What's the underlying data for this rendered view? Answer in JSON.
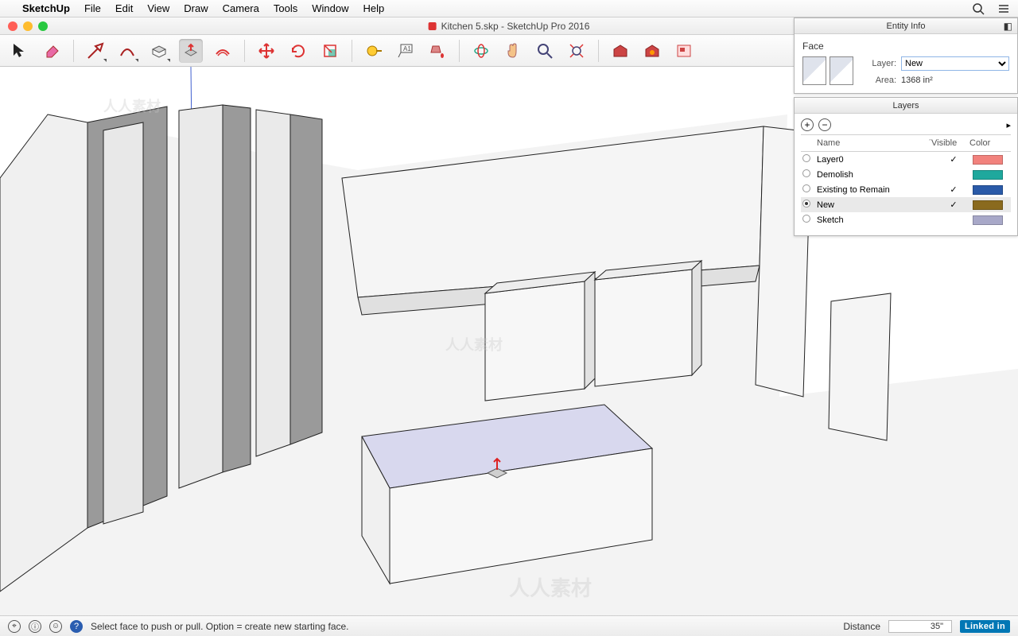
{
  "menubar": {
    "app": "SketchUp",
    "items": [
      "File",
      "Edit",
      "View",
      "Draw",
      "Camera",
      "Tools",
      "Window",
      "Help"
    ]
  },
  "titlebar": {
    "title": "Kitchen 5.skp - SketchUp Pro 2016"
  },
  "toolbar": {
    "tools": [
      {
        "name": "select-tool",
        "icon": "cursor"
      },
      {
        "name": "eraser-tool",
        "icon": "eraser"
      },
      {
        "name": "line-tool",
        "icon": "pencil",
        "dd": true
      },
      {
        "name": "arc-tool",
        "icon": "arc",
        "dd": true
      },
      {
        "name": "shape-tool",
        "icon": "rect",
        "dd": true
      },
      {
        "name": "pushpull-tool",
        "icon": "pushpull",
        "selected": true
      },
      {
        "name": "offset-tool",
        "icon": "offset"
      },
      {
        "name": "move-tool",
        "icon": "move"
      },
      {
        "name": "rotate-tool",
        "icon": "rotate"
      },
      {
        "name": "scale-tool",
        "icon": "scale"
      },
      {
        "name": "tape-tool",
        "icon": "tape"
      },
      {
        "name": "text-tool",
        "icon": "text"
      },
      {
        "name": "paint-tool",
        "icon": "paint"
      },
      {
        "name": "orbit-tool",
        "icon": "orbit"
      },
      {
        "name": "pan-tool",
        "icon": "pan"
      },
      {
        "name": "zoom-tool",
        "icon": "zoom"
      },
      {
        "name": "zoom-extents-tool",
        "icon": "zoomex"
      },
      {
        "name": "3dwarehouse-tool",
        "icon": "wh1"
      },
      {
        "name": "extwarehouse-tool",
        "icon": "wh2"
      },
      {
        "name": "layout-tool",
        "icon": "layout"
      }
    ]
  },
  "entity_info": {
    "panel_title": "Entity Info",
    "type": "Face",
    "layer_label": "Layer:",
    "layer_value": "New",
    "area_label": "Area:",
    "area_value": "1368 in²"
  },
  "layers_panel": {
    "panel_title": "Layers",
    "columns": {
      "name": "Name",
      "visible": "Visible",
      "color": "Color"
    },
    "layers": [
      {
        "name": "Layer0",
        "visible": true,
        "active": false,
        "color": "#f2827d"
      },
      {
        "name": "Demolish",
        "visible": false,
        "active": false,
        "color": "#1fa89d"
      },
      {
        "name": "Existing to Remain",
        "visible": true,
        "active": false,
        "color": "#2a5aa8"
      },
      {
        "name": "New",
        "visible": true,
        "active": true,
        "selected": true,
        "color": "#8a6a1e"
      },
      {
        "name": "Sketch",
        "visible": false,
        "active": false,
        "color": "#a8a8c8"
      }
    ]
  },
  "status": {
    "hint": "Select face to push or pull.  Option = create new starting face.",
    "distance_label": "Distance",
    "distance_value": "35\"",
    "linkedin": "Linked in"
  },
  "watermark": "人人素材"
}
